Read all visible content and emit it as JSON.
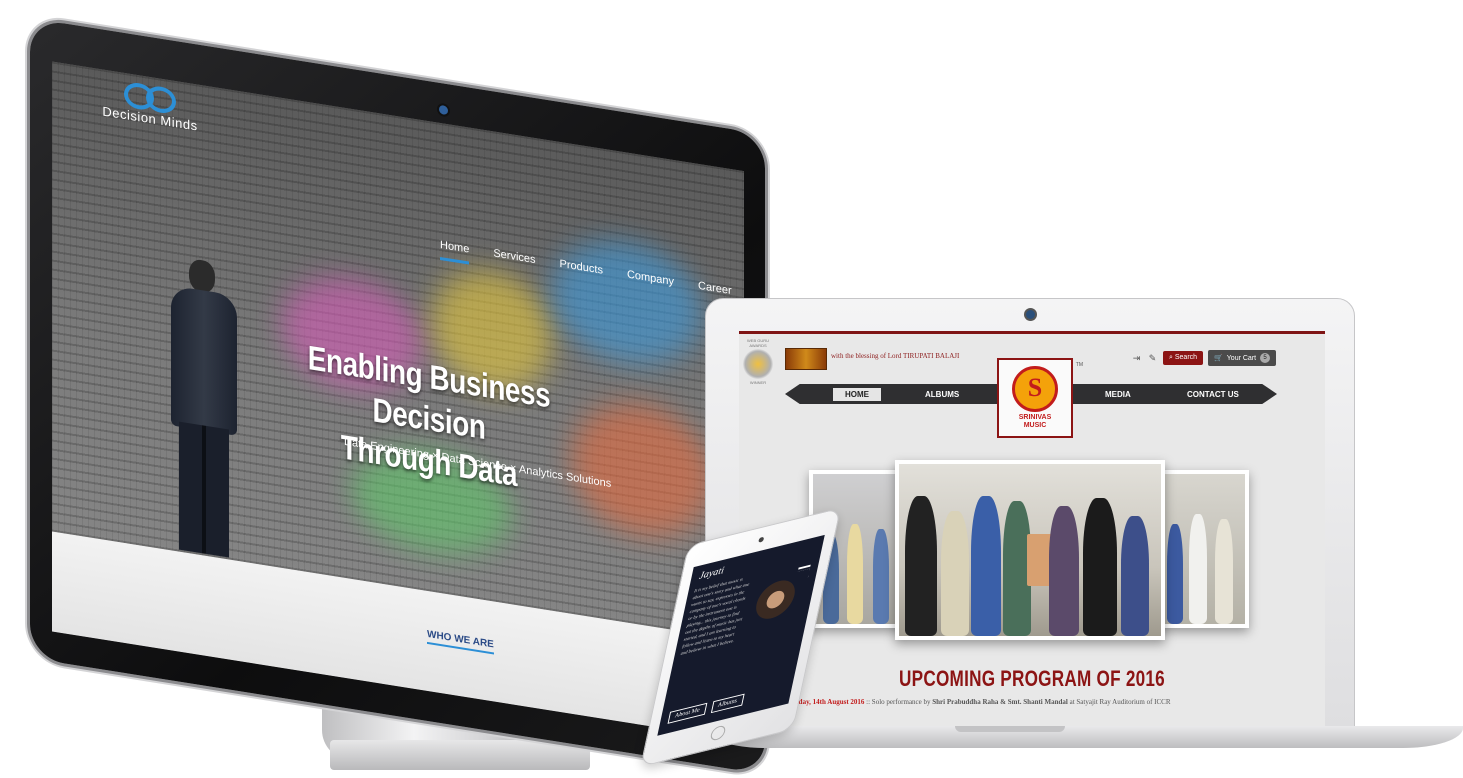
{
  "desktop": {
    "logo_text": "Decision Minds",
    "nav": [
      "Home",
      "Services",
      "Products",
      "Company",
      "Career"
    ],
    "hero_line1": "Enabling Business Decision",
    "hero_line2": "Through Data",
    "subline": "Data Engineering  ×  Data Science  ×  Analytics Solutions",
    "section_label": "WHO WE ARE",
    "accent_color": "#2c8fd6"
  },
  "laptop": {
    "award_text_top": "WEB GURU AWARDS",
    "award_text_bottom": "WINNER",
    "blessing": "with the blessing of Lord TIRUPATI BALAJI",
    "search_label": "Search",
    "cart_label": "Your Cart",
    "cart_count": "5",
    "nav": {
      "home": "HOME",
      "albums": "ALBUMS",
      "media": "MEDIA",
      "contact": "CONTACT US"
    },
    "logo_name_1": "SRINIVAS",
    "logo_name_2": "MUSIC",
    "logo_tm": "TM",
    "heading": "UPCOMING PROGRAM OF 2016",
    "event_date": "Sunday, 14th August 2016",
    "event_text": " :: Solo performance by ",
    "event_artists": "Shri Prabuddha Raha & Smt. Shanti Mandal",
    "event_venue": " at Satyajit Ray Auditorium of ICCR",
    "brand_color": "#8c1414"
  },
  "tablet": {
    "logo": "Jayati",
    "body_text": "It is my belief that music is about one's story and what one wants to say, expresses in the company of one's vocal chords or by the instrument one is playing... this journey to find out the depths of music has just started, and I am learning to follow and listen to my heart and believe in what I believe.",
    "btn_about": "About Me",
    "btn_albums": "Albums"
  }
}
